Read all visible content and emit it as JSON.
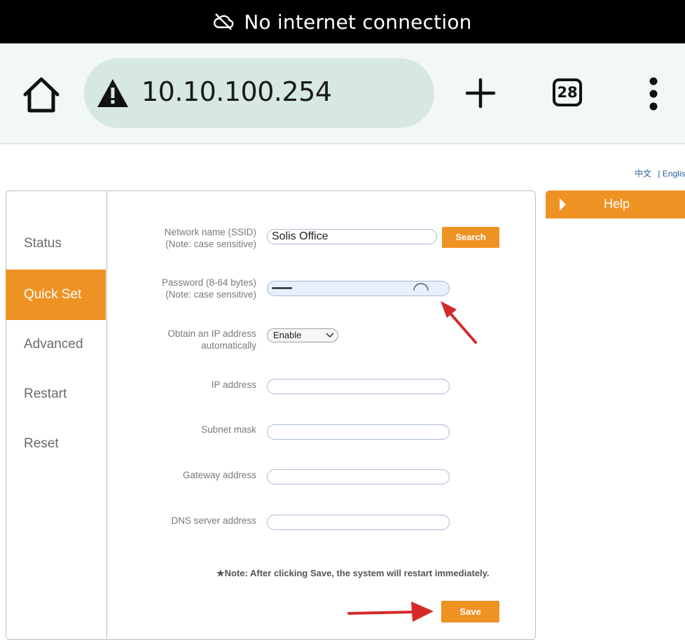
{
  "status_bar": {
    "icon": "cloud-off-icon",
    "text": "No internet connection"
  },
  "browser": {
    "url": "10.10.100.254",
    "tab_count": "28",
    "icons": {
      "home": "home-icon",
      "warning": "warning-icon",
      "new_tab": "plus-icon",
      "menu": "more-vertical-icon"
    }
  },
  "language": {
    "chinese": "中文",
    "separator": "|",
    "english": "Englis"
  },
  "sidebar": {
    "items": [
      {
        "label": "Status",
        "active": false
      },
      {
        "label": "Quick Set",
        "active": true
      },
      {
        "label": "Advanced",
        "active": false
      },
      {
        "label": "Restart",
        "active": false
      },
      {
        "label": "Reset",
        "active": false
      }
    ]
  },
  "form": {
    "ssid": {
      "label_line1": "Network name (SSID)",
      "label_line2": "(Note: case sensitive)",
      "value": "Solis Office"
    },
    "search_label": "Search",
    "password": {
      "label_line1": "Password (8-64 bytes)",
      "label_line2": "(Note: case sensitive)",
      "value": "••••••••••"
    },
    "obtain_ip": {
      "label_line1": "Obtain an IP address",
      "label_line2": "automatically",
      "value": "Enable"
    },
    "ip_address": {
      "label": "IP address",
      "value": ""
    },
    "subnet_mask": {
      "label": "Subnet mask",
      "value": ""
    },
    "gateway": {
      "label": "Gateway address",
      "value": ""
    },
    "dns": {
      "label": "DNS server address",
      "value": ""
    },
    "note": "★Note: After clicking Save, the system will restart immediately.",
    "save_label": "Save"
  },
  "help": {
    "label": "Help"
  },
  "colors": {
    "accent": "#ef9224",
    "annotation_arrow": "#d42a2a",
    "toolbar_bg": "#f2f8f8",
    "omnibox_bg": "#d6e7e4"
  }
}
